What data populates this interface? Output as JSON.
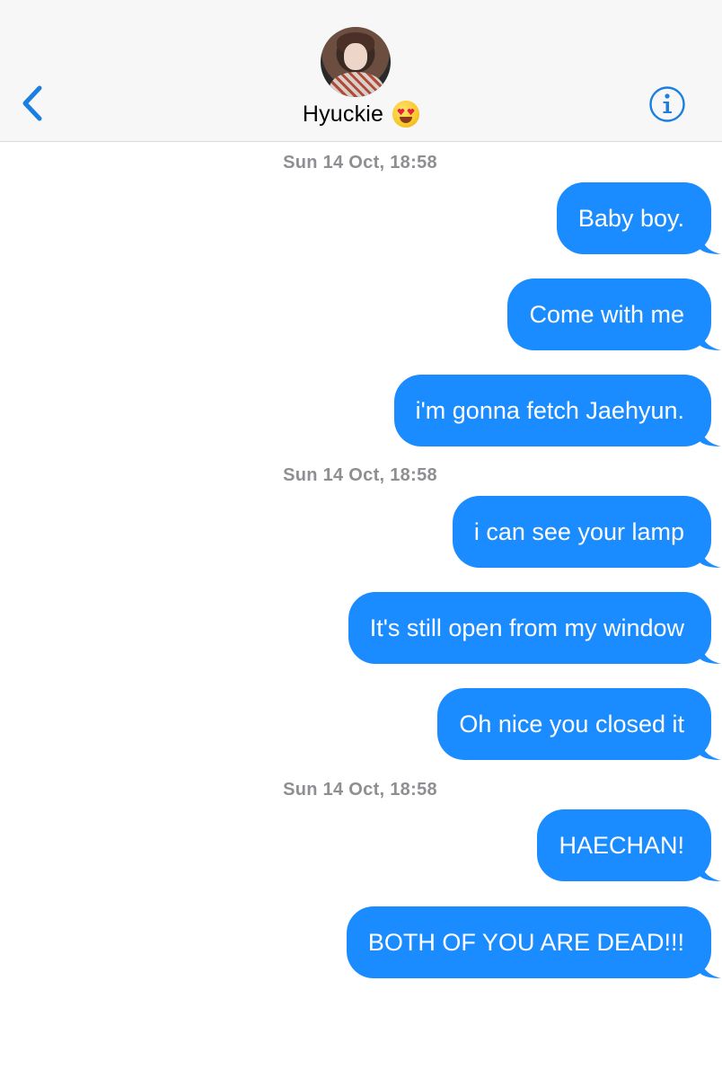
{
  "header": {
    "contact_name": "Hyuckie",
    "contact_emoji": "heart-eyes-emoji",
    "back_icon": "chevron-left-icon",
    "info_icon": "info-icon"
  },
  "colors": {
    "bubble": "#1a8cff",
    "accent": "#1a7fe0",
    "timestamp": "#8e8e93",
    "header_bg": "#f7f7f7"
  },
  "timestamps": [
    "Sun 14 Oct, 18:58",
    "Sun 14 Oct, 18:58",
    "Sun 14 Oct, 18:58"
  ],
  "messages": [
    {
      "text": "Baby boy."
    },
    {
      "text": "Come with me"
    },
    {
      "text": "i'm gonna fetch Jaehyun."
    },
    {
      "text": "i can see your lamp"
    },
    {
      "text": "It's still open from my window"
    },
    {
      "text": "Oh nice you closed it"
    },
    {
      "text": "HAECHAN!"
    },
    {
      "text": "BOTH OF YOU ARE DEAD!!!"
    }
  ]
}
